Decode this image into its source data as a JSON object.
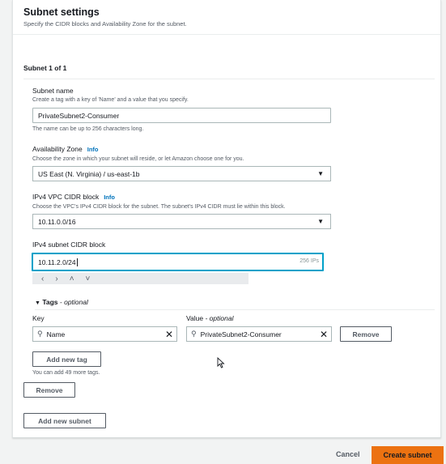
{
  "header": {
    "title": "Subnet settings",
    "description": "Specify the CIDR blocks and Availability Zone for the subnet."
  },
  "subnet": {
    "title": "Subnet 1 of 1",
    "name_label": "Subnet name",
    "name_desc": "Create a tag with a key of 'Name' and a value that you specify.",
    "name_value": "PrivateSubnet2-Consumer",
    "name_hint": "The name can be up to 256 characters long.",
    "az_label": "Availability Zone",
    "az_info": "Info",
    "az_desc": "Choose the zone in which your subnet will reside, or let Amazon choose one for you.",
    "az_value": "US East (N. Virginia) / us-east-1b",
    "vpc_cidr_label": "IPv4 VPC CIDR block",
    "vpc_cidr_info": "Info",
    "vpc_cidr_desc": "Choose the VPC's IPv4 CIDR block for the subnet. The subnet's IPv4 CIDR must lie within this block.",
    "vpc_cidr_value": "10.11.0.0/16",
    "subnet_cidr_label": "IPv4 subnet CIDR block",
    "subnet_cidr_value": "10.11.2.0/24",
    "subnet_cidr_ips": "256 IPs"
  },
  "stepper": {
    "left": "<",
    "right": ">",
    "up": "^",
    "down": "v"
  },
  "tags": {
    "heading": "Tags",
    "heading_optional": "- optional",
    "key_label": "Key",
    "value_label": "Value",
    "value_optional": "- optional",
    "key_value": "Name",
    "value_value": "PrivateSubnet2-Consumer",
    "remove_label": "Remove",
    "add_tag_label": "Add new tag",
    "limit_text": "You can add 49 more tags."
  },
  "actions": {
    "remove_subnet": "Remove",
    "add_subnet": "Add new subnet",
    "cancel": "Cancel",
    "create": "Create subnet"
  },
  "colors": {
    "accent": "#ec7211",
    "focus": "#00a1c9",
    "link": "#0073bb"
  }
}
